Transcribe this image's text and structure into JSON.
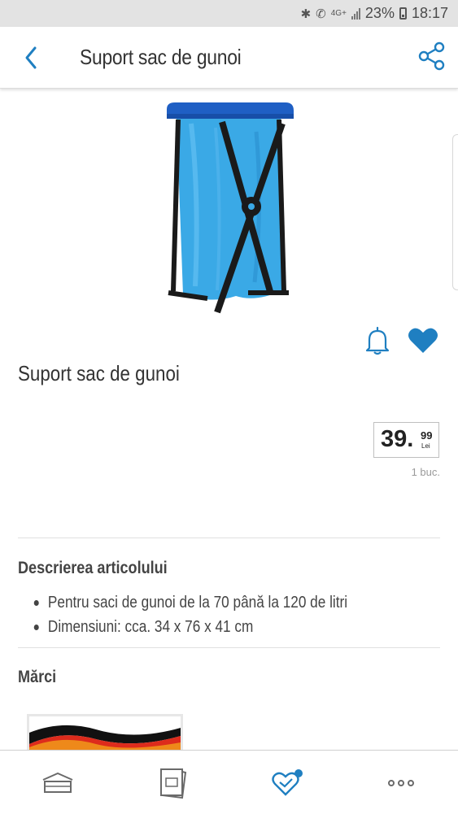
{
  "status_bar": {
    "network": "4G+",
    "battery": "23%",
    "time": "18:17"
  },
  "header": {
    "title": "Suport sac de gunoi",
    "back_icon": "chevron-left-icon",
    "share_icon": "share-icon"
  },
  "product": {
    "title": "Suport sac de gunoi",
    "price": {
      "main": "39.",
      "cents": "99",
      "currency": "Lei"
    },
    "unit": "1 buc.",
    "notify_icon": "bell-icon",
    "favorite_icon": "heart-icon"
  },
  "description": {
    "heading": "Descrierea articolului",
    "items": [
      "Pentru saci de gunoi de la 70 până la 120 de litri",
      "Dimensiuni: cca. 34 x 76 x 41 cm"
    ]
  },
  "brands": {
    "heading": "Mărci"
  },
  "bottom_nav": {
    "items": [
      {
        "icon": "home-icon"
      },
      {
        "icon": "flyer-icon"
      },
      {
        "icon": "favorites-icon"
      },
      {
        "icon": "more-icon"
      }
    ]
  },
  "colors": {
    "accent": "#1f7fc1",
    "text": "#333333",
    "divider": "#e0e0e0"
  }
}
